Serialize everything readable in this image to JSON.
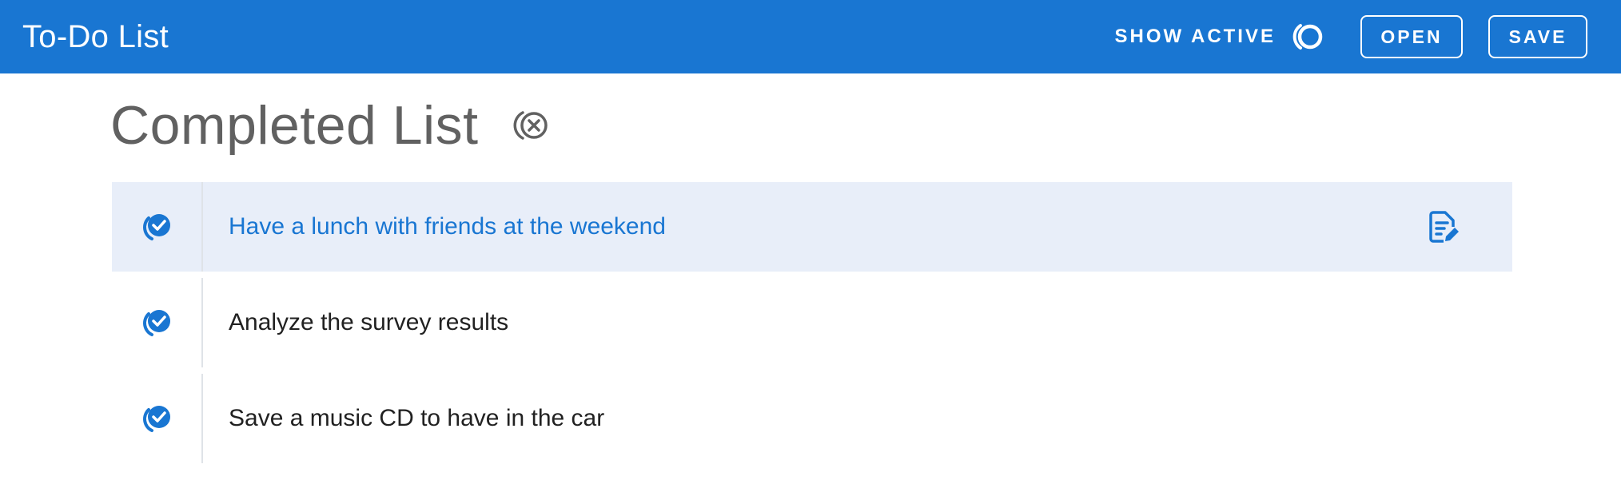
{
  "app_bar": {
    "title": "To-Do List",
    "show_active_label": "SHOW ACTIVE",
    "show_active_icon": "toggle-circle-icon",
    "open_label": "OPEN",
    "save_label": "SAVE",
    "background_color": "#1976d2"
  },
  "main": {
    "title": "Completed List",
    "clear_icon": "clear-completed-icon"
  },
  "todos": [
    {
      "text": "Have a lunch with friends at the weekend",
      "completed": true,
      "selected": true,
      "icon": "check-circle-icon",
      "action_icon": "edit-note-icon"
    },
    {
      "text": "Analyze the survey results",
      "completed": true,
      "selected": false,
      "icon": "check-circle-icon"
    },
    {
      "text": "Save a music CD to have in the car",
      "completed": true,
      "selected": false,
      "icon": "check-circle-icon"
    }
  ],
  "colors": {
    "accent": "#1976d2",
    "selected_row": "#e8eef9",
    "title_text": "#616161"
  }
}
